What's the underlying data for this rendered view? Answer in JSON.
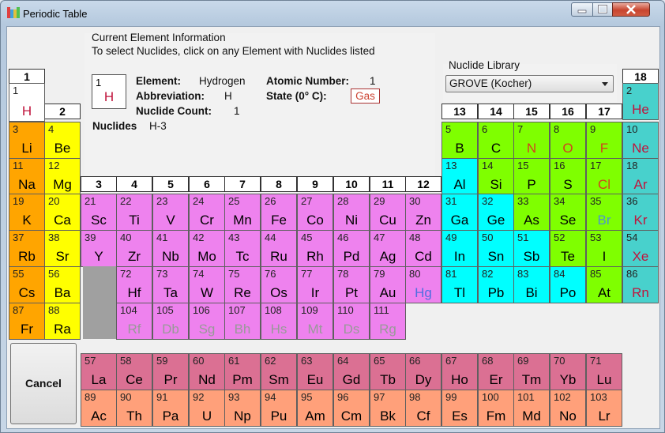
{
  "window": {
    "title": "Periodic Table"
  },
  "info": {
    "heading": "Current Element Information",
    "instruction": "To select Nuclides, click on any Element with Nuclides listed",
    "card_number": "1",
    "card_symbol": "H",
    "element_label": "Element:",
    "element_value": "Hydrogen",
    "abbrev_label": "Abbreviation:",
    "abbrev_value": "H",
    "count_label": "Nuclide Count:",
    "count_value": "1",
    "atomic_label": "Atomic Number:",
    "atomic_value": "1",
    "state_label": "State (0° C):",
    "state_value": "Gas",
    "nuclides_label": "Nuclides",
    "nuclides_value": "H-3"
  },
  "library": {
    "label": "Nuclide Library",
    "selected": "GROVE (Kocher)"
  },
  "cancel_label": "Cancel",
  "group_headers": [
    "1",
    "2",
    "3",
    "4",
    "5",
    "6",
    "7",
    "8",
    "9",
    "10",
    "11",
    "12",
    "13",
    "14",
    "15",
    "16",
    "17",
    "18"
  ],
  "colors": {
    "alkali": "#ffa500",
    "alkaline": "#ffff00",
    "transition": "#ee82ee",
    "post": "#00ffff",
    "nonmetal": "#7fff00",
    "noble": "#48d1cc",
    "lanthanide": "#db7093",
    "actinide": "#ffa07a",
    "hydrogen": "#ffffff",
    "gray": "#a0a0a0"
  },
  "elements": [
    {
      "n": "1",
      "s": "H",
      "r": 1,
      "c": 1,
      "cat": "hydrogen",
      "tc": "#c0143c"
    },
    {
      "n": "2",
      "s": "He",
      "r": 1,
      "c": 18,
      "cat": "noble",
      "tc": "#c0143c"
    },
    {
      "n": "3",
      "s": "Li",
      "r": 2,
      "c": 1,
      "cat": "alkali"
    },
    {
      "n": "4",
      "s": "Be",
      "r": 2,
      "c": 2,
      "cat": "alkaline"
    },
    {
      "n": "5",
      "s": "B",
      "r": 2,
      "c": 13,
      "cat": "nonmetal"
    },
    {
      "n": "6",
      "s": "C",
      "r": 2,
      "c": 14,
      "cat": "nonmetal"
    },
    {
      "n": "7",
      "s": "N",
      "r": 2,
      "c": 15,
      "cat": "nonmetal",
      "tc": "#d2421e"
    },
    {
      "n": "8",
      "s": "O",
      "r": 2,
      "c": 16,
      "cat": "nonmetal",
      "tc": "#d2421e"
    },
    {
      "n": "9",
      "s": "F",
      "r": 2,
      "c": 17,
      "cat": "nonmetal",
      "tc": "#d2421e"
    },
    {
      "n": "10",
      "s": "Ne",
      "r": 2,
      "c": 18,
      "cat": "noble",
      "tc": "#c0143c"
    },
    {
      "n": "11",
      "s": "Na",
      "r": 3,
      "c": 1,
      "cat": "alkali"
    },
    {
      "n": "12",
      "s": "Mg",
      "r": 3,
      "c": 2,
      "cat": "alkaline"
    },
    {
      "n": "13",
      "s": "Al",
      "r": 3,
      "c": 13,
      "cat": "post"
    },
    {
      "n": "14",
      "s": "Si",
      "r": 3,
      "c": 14,
      "cat": "nonmetal"
    },
    {
      "n": "15",
      "s": "P",
      "r": 3,
      "c": 15,
      "cat": "nonmetal"
    },
    {
      "n": "16",
      "s": "S",
      "r": 3,
      "c": 16,
      "cat": "nonmetal"
    },
    {
      "n": "17",
      "s": "Cl",
      "r": 3,
      "c": 17,
      "cat": "nonmetal",
      "tc": "#d2421e"
    },
    {
      "n": "18",
      "s": "Ar",
      "r": 3,
      "c": 18,
      "cat": "noble",
      "tc": "#c0143c"
    },
    {
      "n": "19",
      "s": "K",
      "r": 4,
      "c": 1,
      "cat": "alkali"
    },
    {
      "n": "20",
      "s": "Ca",
      "r": 4,
      "c": 2,
      "cat": "alkaline"
    },
    {
      "n": "21",
      "s": "Sc",
      "r": 4,
      "c": 3,
      "cat": "transition"
    },
    {
      "n": "22",
      "s": "Ti",
      "r": 4,
      "c": 4,
      "cat": "transition"
    },
    {
      "n": "23",
      "s": "V",
      "r": 4,
      "c": 5,
      "cat": "transition"
    },
    {
      "n": "24",
      "s": "Cr",
      "r": 4,
      "c": 6,
      "cat": "transition"
    },
    {
      "n": "25",
      "s": "Mn",
      "r": 4,
      "c": 7,
      "cat": "transition"
    },
    {
      "n": "26",
      "s": "Fe",
      "r": 4,
      "c": 8,
      "cat": "transition"
    },
    {
      "n": "27",
      "s": "Co",
      "r": 4,
      "c": 9,
      "cat": "transition"
    },
    {
      "n": "28",
      "s": "Ni",
      "r": 4,
      "c": 10,
      "cat": "transition"
    },
    {
      "n": "29",
      "s": "Cu",
      "r": 4,
      "c": 11,
      "cat": "transition"
    },
    {
      "n": "30",
      "s": "Zn",
      "r": 4,
      "c": 12,
      "cat": "transition"
    },
    {
      "n": "31",
      "s": "Ga",
      "r": 4,
      "c": 13,
      "cat": "post"
    },
    {
      "n": "32",
      "s": "Ge",
      "r": 4,
      "c": 14,
      "cat": "post"
    },
    {
      "n": "33",
      "s": "As",
      "r": 4,
      "c": 15,
      "cat": "nonmetal"
    },
    {
      "n": "34",
      "s": "Se",
      "r": 4,
      "c": 16,
      "cat": "nonmetal"
    },
    {
      "n": "35",
      "s": "Br",
      "r": 4,
      "c": 17,
      "cat": "nonmetal",
      "tc": "#4f94cd"
    },
    {
      "n": "36",
      "s": "Kr",
      "r": 4,
      "c": 18,
      "cat": "noble",
      "tc": "#c0143c"
    },
    {
      "n": "37",
      "s": "Rb",
      "r": 5,
      "c": 1,
      "cat": "alkali"
    },
    {
      "n": "38",
      "s": "Sr",
      "r": 5,
      "c": 2,
      "cat": "alkaline"
    },
    {
      "n": "39",
      "s": "Y",
      "r": 5,
      "c": 3,
      "cat": "transition"
    },
    {
      "n": "40",
      "s": "Zr",
      "r": 5,
      "c": 4,
      "cat": "transition"
    },
    {
      "n": "41",
      "s": "Nb",
      "r": 5,
      "c": 5,
      "cat": "transition"
    },
    {
      "n": "42",
      "s": "Mo",
      "r": 5,
      "c": 6,
      "cat": "transition"
    },
    {
      "n": "43",
      "s": "Tc",
      "r": 5,
      "c": 7,
      "cat": "transition"
    },
    {
      "n": "44",
      "s": "Ru",
      "r": 5,
      "c": 8,
      "cat": "transition"
    },
    {
      "n": "45",
      "s": "Rh",
      "r": 5,
      "c": 9,
      "cat": "transition"
    },
    {
      "n": "46",
      "s": "Pd",
      "r": 5,
      "c": 10,
      "cat": "transition"
    },
    {
      "n": "47",
      "s": "Ag",
      "r": 5,
      "c": 11,
      "cat": "transition"
    },
    {
      "n": "48",
      "s": "Cd",
      "r": 5,
      "c": 12,
      "cat": "transition"
    },
    {
      "n": "49",
      "s": "In",
      "r": 5,
      "c": 13,
      "cat": "post"
    },
    {
      "n": "50",
      "s": "Sn",
      "r": 5,
      "c": 14,
      "cat": "post"
    },
    {
      "n": "51",
      "s": "Sb",
      "r": 5,
      "c": 15,
      "cat": "post"
    },
    {
      "n": "52",
      "s": "Te",
      "r": 5,
      "c": 16,
      "cat": "nonmetal"
    },
    {
      "n": "53",
      "s": "I",
      "r": 5,
      "c": 17,
      "cat": "nonmetal"
    },
    {
      "n": "54",
      "s": "Xe",
      "r": 5,
      "c": 18,
      "cat": "noble",
      "tc": "#c0143c"
    },
    {
      "n": "55",
      "s": "Cs",
      "r": 6,
      "c": 1,
      "cat": "alkali"
    },
    {
      "n": "56",
      "s": "Ba",
      "r": 6,
      "c": 2,
      "cat": "alkaline"
    },
    {
      "n": "72",
      "s": "Hf",
      "r": 6,
      "c": 4,
      "cat": "transition"
    },
    {
      "n": "73",
      "s": "Ta",
      "r": 6,
      "c": 5,
      "cat": "transition"
    },
    {
      "n": "74",
      "s": "W",
      "r": 6,
      "c": 6,
      "cat": "transition"
    },
    {
      "n": "75",
      "s": "Re",
      "r": 6,
      "c": 7,
      "cat": "transition"
    },
    {
      "n": "76",
      "s": "Os",
      "r": 6,
      "c": 8,
      "cat": "transition"
    },
    {
      "n": "77",
      "s": "Ir",
      "r": 6,
      "c": 9,
      "cat": "transition"
    },
    {
      "n": "78",
      "s": "Pt",
      "r": 6,
      "c": 10,
      "cat": "transition"
    },
    {
      "n": "79",
      "s": "Au",
      "r": 6,
      "c": 11,
      "cat": "transition"
    },
    {
      "n": "80",
      "s": "Hg",
      "r": 6,
      "c": 12,
      "cat": "transition",
      "tc": "#4f6fe0"
    },
    {
      "n": "81",
      "s": "Tl",
      "r": 6,
      "c": 13,
      "cat": "post"
    },
    {
      "n": "82",
      "s": "Pb",
      "r": 6,
      "c": 14,
      "cat": "post"
    },
    {
      "n": "83",
      "s": "Bi",
      "r": 6,
      "c": 15,
      "cat": "post"
    },
    {
      "n": "84",
      "s": "Po",
      "r": 6,
      "c": 16,
      "cat": "post"
    },
    {
      "n": "85",
      "s": "At",
      "r": 6,
      "c": 17,
      "cat": "nonmetal"
    },
    {
      "n": "86",
      "s": "Rn",
      "r": 6,
      "c": 18,
      "cat": "noble",
      "tc": "#c0143c"
    },
    {
      "n": "87",
      "s": "Fr",
      "r": 7,
      "c": 1,
      "cat": "alkali"
    },
    {
      "n": "88",
      "s": "Ra",
      "r": 7,
      "c": 2,
      "cat": "alkaline"
    },
    {
      "n": "104",
      "s": "Rf",
      "r": 7,
      "c": 4,
      "cat": "transition",
      "tc": "#999999"
    },
    {
      "n": "105",
      "s": "Db",
      "r": 7,
      "c": 5,
      "cat": "transition",
      "tc": "#999999"
    },
    {
      "n": "106",
      "s": "Sg",
      "r": 7,
      "c": 6,
      "cat": "transition",
      "tc": "#999999"
    },
    {
      "n": "107",
      "s": "Bh",
      "r": 7,
      "c": 7,
      "cat": "transition",
      "tc": "#999999"
    },
    {
      "n": "108",
      "s": "Hs",
      "r": 7,
      "c": 8,
      "cat": "transition",
      "tc": "#999999"
    },
    {
      "n": "109",
      "s": "Mt",
      "r": 7,
      "c": 9,
      "cat": "transition",
      "tc": "#999999"
    },
    {
      "n": "110",
      "s": "Ds",
      "r": 7,
      "c": 10,
      "cat": "transition",
      "tc": "#999999"
    },
    {
      "n": "111",
      "s": "Rg",
      "r": 7,
      "c": 11,
      "cat": "transition",
      "tc": "#999999"
    },
    {
      "n": "57",
      "s": "La",
      "r": 9,
      "c": 3,
      "cat": "lanthanide"
    },
    {
      "n": "58",
      "s": "Ce",
      "r": 9,
      "c": 4,
      "cat": "lanthanide"
    },
    {
      "n": "59",
      "s": "Pr",
      "r": 9,
      "c": 5,
      "cat": "lanthanide"
    },
    {
      "n": "60",
      "s": "Nd",
      "r": 9,
      "c": 6,
      "cat": "lanthanide"
    },
    {
      "n": "61",
      "s": "Pm",
      "r": 9,
      "c": 7,
      "cat": "lanthanide"
    },
    {
      "n": "62",
      "s": "Sm",
      "r": 9,
      "c": 8,
      "cat": "lanthanide"
    },
    {
      "n": "63",
      "s": "Eu",
      "r": 9,
      "c": 9,
      "cat": "lanthanide"
    },
    {
      "n": "64",
      "s": "Gd",
      "r": 9,
      "c": 10,
      "cat": "lanthanide"
    },
    {
      "n": "65",
      "s": "Tb",
      "r": 9,
      "c": 11,
      "cat": "lanthanide"
    },
    {
      "n": "66",
      "s": "Dy",
      "r": 9,
      "c": 12,
      "cat": "lanthanide"
    },
    {
      "n": "67",
      "s": "Ho",
      "r": 9,
      "c": 13,
      "cat": "lanthanide"
    },
    {
      "n": "68",
      "s": "Er",
      "r": 9,
      "c": 14,
      "cat": "lanthanide"
    },
    {
      "n": "69",
      "s": "Tm",
      "r": 9,
      "c": 15,
      "cat": "lanthanide"
    },
    {
      "n": "70",
      "s": "Yb",
      "r": 9,
      "c": 16,
      "cat": "lanthanide"
    },
    {
      "n": "71",
      "s": "Lu",
      "r": 9,
      "c": 17,
      "cat": "lanthanide"
    },
    {
      "n": "89",
      "s": "Ac",
      "r": 10,
      "c": 3,
      "cat": "actinide"
    },
    {
      "n": "90",
      "s": "Th",
      "r": 10,
      "c": 4,
      "cat": "actinide"
    },
    {
      "n": "91",
      "s": "Pa",
      "r": 10,
      "c": 5,
      "cat": "actinide"
    },
    {
      "n": "92",
      "s": "U",
      "r": 10,
      "c": 6,
      "cat": "actinide"
    },
    {
      "n": "93",
      "s": "Np",
      "r": 10,
      "c": 7,
      "cat": "actinide"
    },
    {
      "n": "94",
      "s": "Pu",
      "r": 10,
      "c": 8,
      "cat": "actinide"
    },
    {
      "n": "95",
      "s": "Am",
      "r": 10,
      "c": 9,
      "cat": "actinide"
    },
    {
      "n": "96",
      "s": "Cm",
      "r": 10,
      "c": 10,
      "cat": "actinide"
    },
    {
      "n": "97",
      "s": "Bk",
      "r": 10,
      "c": 11,
      "cat": "actinide"
    },
    {
      "n": "98",
      "s": "Cf",
      "r": 10,
      "c": 12,
      "cat": "actinide"
    },
    {
      "n": "99",
      "s": "Es",
      "r": 10,
      "c": 13,
      "cat": "actinide"
    },
    {
      "n": "100",
      "s": "Fm",
      "r": 10,
      "c": 14,
      "cat": "actinide"
    },
    {
      "n": "101",
      "s": "Md",
      "r": 10,
      "c": 15,
      "cat": "actinide"
    },
    {
      "n": "102",
      "s": "No",
      "r": 10,
      "c": 16,
      "cat": "actinide"
    },
    {
      "n": "103",
      "s": "Lr",
      "r": 10,
      "c": 17,
      "cat": "actinide"
    }
  ]
}
